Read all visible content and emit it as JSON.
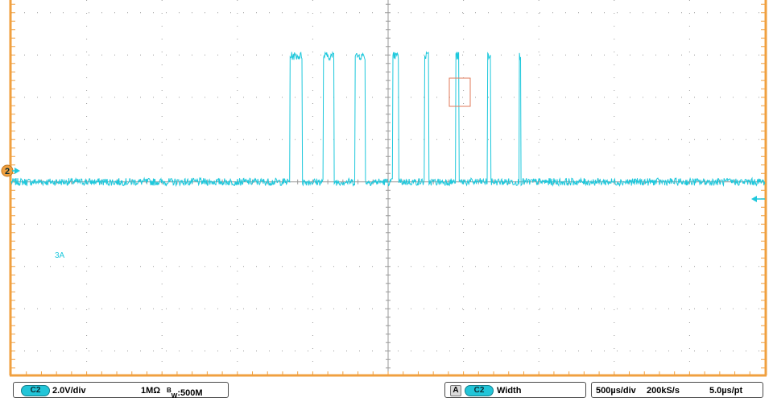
{
  "colors": {
    "frame": "#f0a040",
    "grid": "#9a9a9a",
    "trace": "#1ec8dc",
    "marker": "#e07a5a",
    "background": "#ffffff"
  },
  "display": {
    "channel_marker_label": "2",
    "math_label": "3A",
    "trigger_icon": "arrow-left-icon",
    "channel_arrow_icon": "arrow-right-icon"
  },
  "status": {
    "channel_badge": "C2",
    "vertical_scale": "2.0V/div",
    "impedance": "1MΩ",
    "bandwidth_prefix": "B",
    "bandwidth_sub": "W",
    "bandwidth_value": ":500M",
    "measure_source_letter": "A",
    "measure_channel_badge": "C2",
    "measure_type": "Width",
    "timebase": "500µs/div",
    "sample_rate": "200kS/s",
    "resolution": "5.0µs/pt"
  },
  "chart_data": {
    "type": "line",
    "title": "",
    "xlabel": "",
    "ylabel": "",
    "grid": true,
    "x_divisions": 10,
    "y_divisions": 8,
    "xlim": [
      -2.5,
      2.5
    ],
    "ylim": [
      -8.3,
      7.8
    ],
    "x_unit": "ms",
    "y_unit": "V",
    "series": [
      {
        "baseline": 0.0,
        "high_level": 5.4,
        "pulses": [
          {
            "start": -0.65,
            "end": -0.57
          },
          {
            "start": -0.43,
            "end": -0.36
          },
          {
            "start": -0.22,
            "end": -0.15
          },
          {
            "start": 0.03,
            "end": 0.07
          },
          {
            "start": 0.24,
            "end": 0.27
          },
          {
            "start": 0.45,
            "end": 0.47
          },
          {
            "start": 0.66,
            "end": 0.68
          },
          {
            "start": 0.87,
            "end": 0.88
          }
        ]
      }
    ]
  }
}
